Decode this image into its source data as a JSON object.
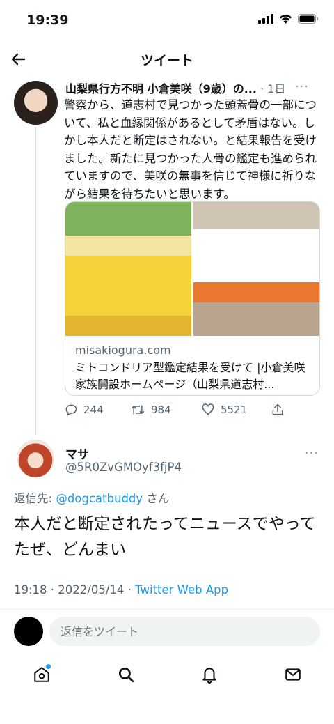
{
  "status_bar": {
    "time": "19:39"
  },
  "nav": {
    "title": "ツイート"
  },
  "tweet1": {
    "author_name": "山梨県行方不明 小倉美咲（9歳）の...",
    "time": "· 1日",
    "more": "···",
    "text": "警察から、道志村で見つかった頭蓋骨の一部について、私と血縁関係があるとして矛盾はない。しかし本人だと断定はされない。と結果報告を受けました。新たに見つかった人骨の鑑定も進められていますので、美咲の無事を信じて神様に祈りながら結果を待ちたいと思います。",
    "card": {
      "domain": "misakiogura.com",
      "title": "ミトコンドリア型鑑定結果を受けて |小倉美咲 家族開設ホームページ（山梨県道志村..."
    },
    "stats": {
      "replies": "244",
      "retweets": "984",
      "likes": "5521"
    }
  },
  "tweet2": {
    "name": "マサ",
    "handle": "@5R0ZvGMOyf3fjP4",
    "more": "···",
    "reply_prefix": "返信先: ",
    "reply_mention": "@dogcatbuddy",
    "reply_suffix": "さん",
    "text": "本人だと断定されたってニュースでやってたぜ、どんまい",
    "timestamp": "19:18 · 2022/05/14 · ",
    "source": "Twitter Web App"
  },
  "reply_box": {
    "placeholder": "返信をツイート"
  },
  "colors": {
    "accent": "#1d9bf0",
    "secondary_text": "#536471",
    "border": "#cfd9de"
  },
  "icons": [
    "back-arrow-icon",
    "reply-icon",
    "retweet-icon",
    "like-icon",
    "share-icon",
    "home-icon",
    "search-icon",
    "bell-icon",
    "mail-icon"
  ]
}
